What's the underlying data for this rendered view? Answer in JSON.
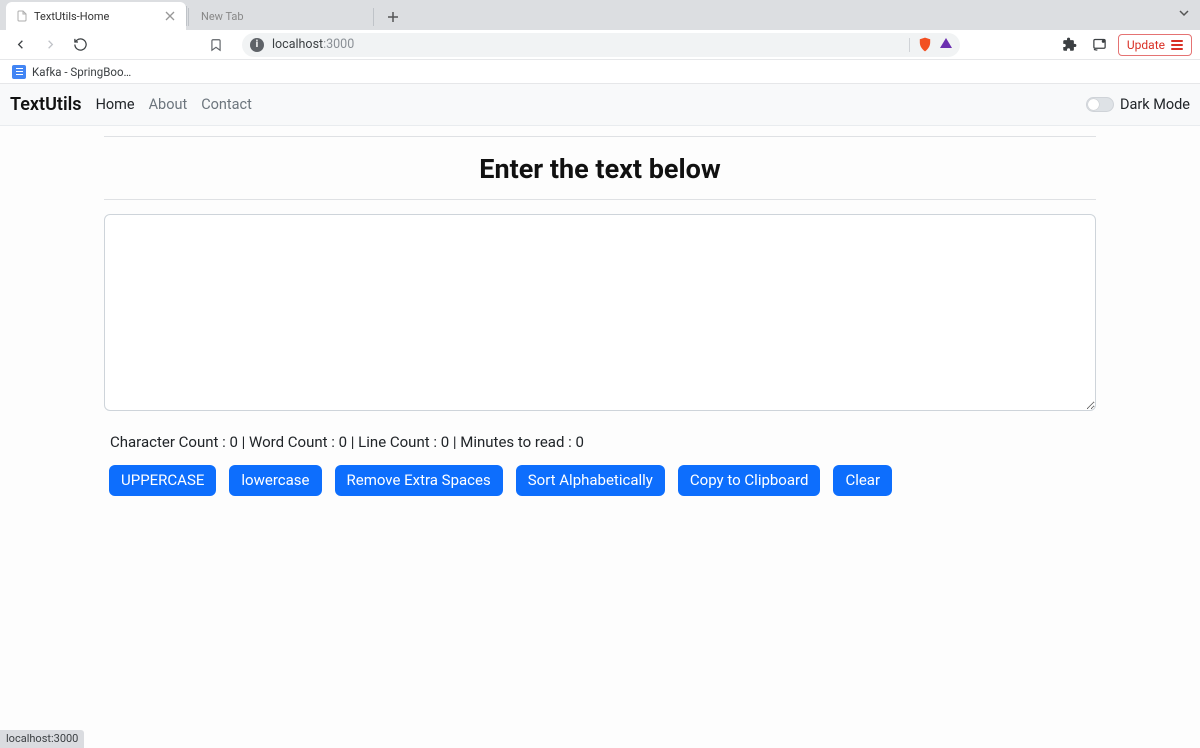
{
  "chrome": {
    "tabs": [
      {
        "title": "TextUtils-Home",
        "active": true
      },
      {
        "title": "New Tab",
        "active": false
      }
    ],
    "back_disabled": false,
    "forward_disabled": true,
    "bookmark_icon": "bookmark-outline",
    "address_prefix_icon": "info",
    "address_host": "localhost",
    "address_port": ":3000",
    "brave_shield_icon": "brave-shield",
    "brave_rewards_icon": "triangle",
    "extensions_icon": "puzzle",
    "cast_icon": "cast",
    "update_label": "Update",
    "bookmarks": [
      {
        "icon": "google-docs",
        "label": "Kafka - SpringBoo…"
      }
    ],
    "tabstrip_caret": "chevron-down"
  },
  "navbar": {
    "brand": "TextUtils",
    "links": [
      {
        "label": "Home",
        "active": true
      },
      {
        "label": "About",
        "active": false
      },
      {
        "label": "Contact",
        "active": false
      }
    ],
    "dark_mode_label": "Dark Mode",
    "dark_mode_on": false
  },
  "main": {
    "heading": "Enter the text below",
    "textarea_value": "",
    "stats_line": "Character Count : 0 | Word Count : 0 | Line Count : 0 | Minutes to read : 0",
    "stats": {
      "char_count": 0,
      "word_count": 0,
      "line_count": 0,
      "minutes_to_read": 0
    },
    "buttons": [
      "UPPERCASE",
      "lowercase",
      "Remove Extra Spaces",
      "Sort Alphabetically",
      "Copy to Clipboard",
      "Clear"
    ]
  },
  "statusbar": {
    "text": "localhost:3000"
  }
}
